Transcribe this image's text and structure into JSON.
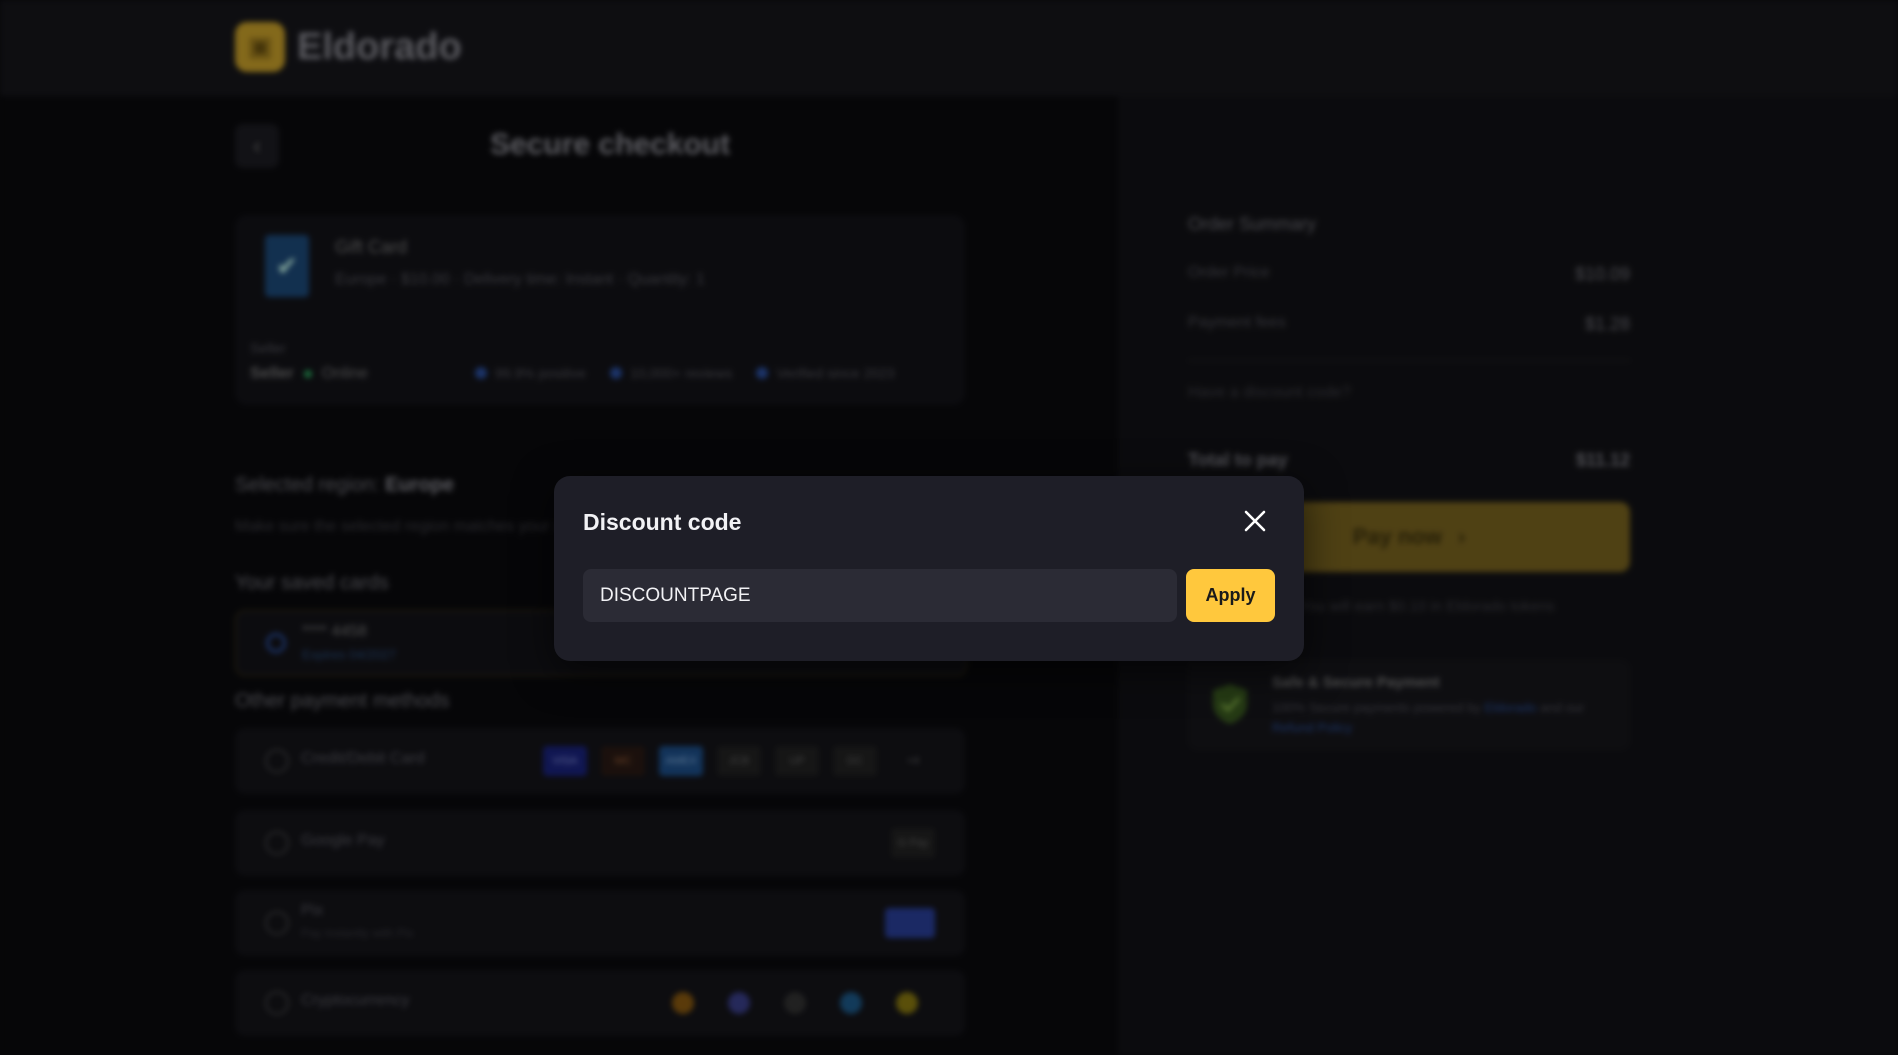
{
  "header": {
    "brand": "Eldorado"
  },
  "checkout": {
    "title": "Secure checkout",
    "product": {
      "name": "Gift Card",
      "meta": "Europe · $10.00 · Delivery time: Instant · Quantity: 1",
      "seller_label": "Seller",
      "seller_name": "Seller",
      "seller_status": "Online",
      "badges": [
        "99.9% positive",
        "10,000+ reviews",
        "Verified since 2023"
      ]
    },
    "region_label": "Selected region:",
    "region_value": "Europe",
    "region_note": "Make sure the selected region matches your account",
    "saved_cards_label": "Your saved cards",
    "saved_card": {
      "number": "**** 4458",
      "expiry": "Expires 04/2027"
    },
    "other_methods_label": "Other payment methods",
    "methods": [
      {
        "label": "Credit/Debit Card",
        "sub": ""
      },
      {
        "label": "Google Pay",
        "sub": ""
      },
      {
        "label": "Pix",
        "sub": "Pay instantly with Pix"
      },
      {
        "label": "Cryptocurrency",
        "sub": ""
      }
    ],
    "card_logos": [
      "VISA",
      "MC",
      "AMEX",
      "JCB",
      "UP",
      "DC",
      "+4"
    ],
    "gpay_logo": "G Pay"
  },
  "summary": {
    "title": "Order Summary",
    "order_price_label": "Order Price",
    "order_price": "$10.09",
    "payment_fees_label": "Payment fees",
    "payment_fees": "$1.28",
    "discount_link": "Have a discount code?",
    "total_label": "Total to pay",
    "total": "$11.12",
    "pay_button": "Pay now",
    "pay_note": "You will earn $0.10 in Eldorado tokens",
    "secure_title": "Safe & Secure Payment",
    "secure_desc": "100% Secure payments powered by",
    "secure_link1": "Eldorado",
    "secure_and": "and our",
    "secure_link2": "Refund Policy"
  },
  "modal": {
    "title": "Discount code",
    "input_value": "DISCOUNTPAGE",
    "apply_label": "Apply"
  },
  "colors": {
    "accent": "#ffc83d",
    "modal_bg": "#1e1e27",
    "input_bg": "#2b2b35"
  }
}
